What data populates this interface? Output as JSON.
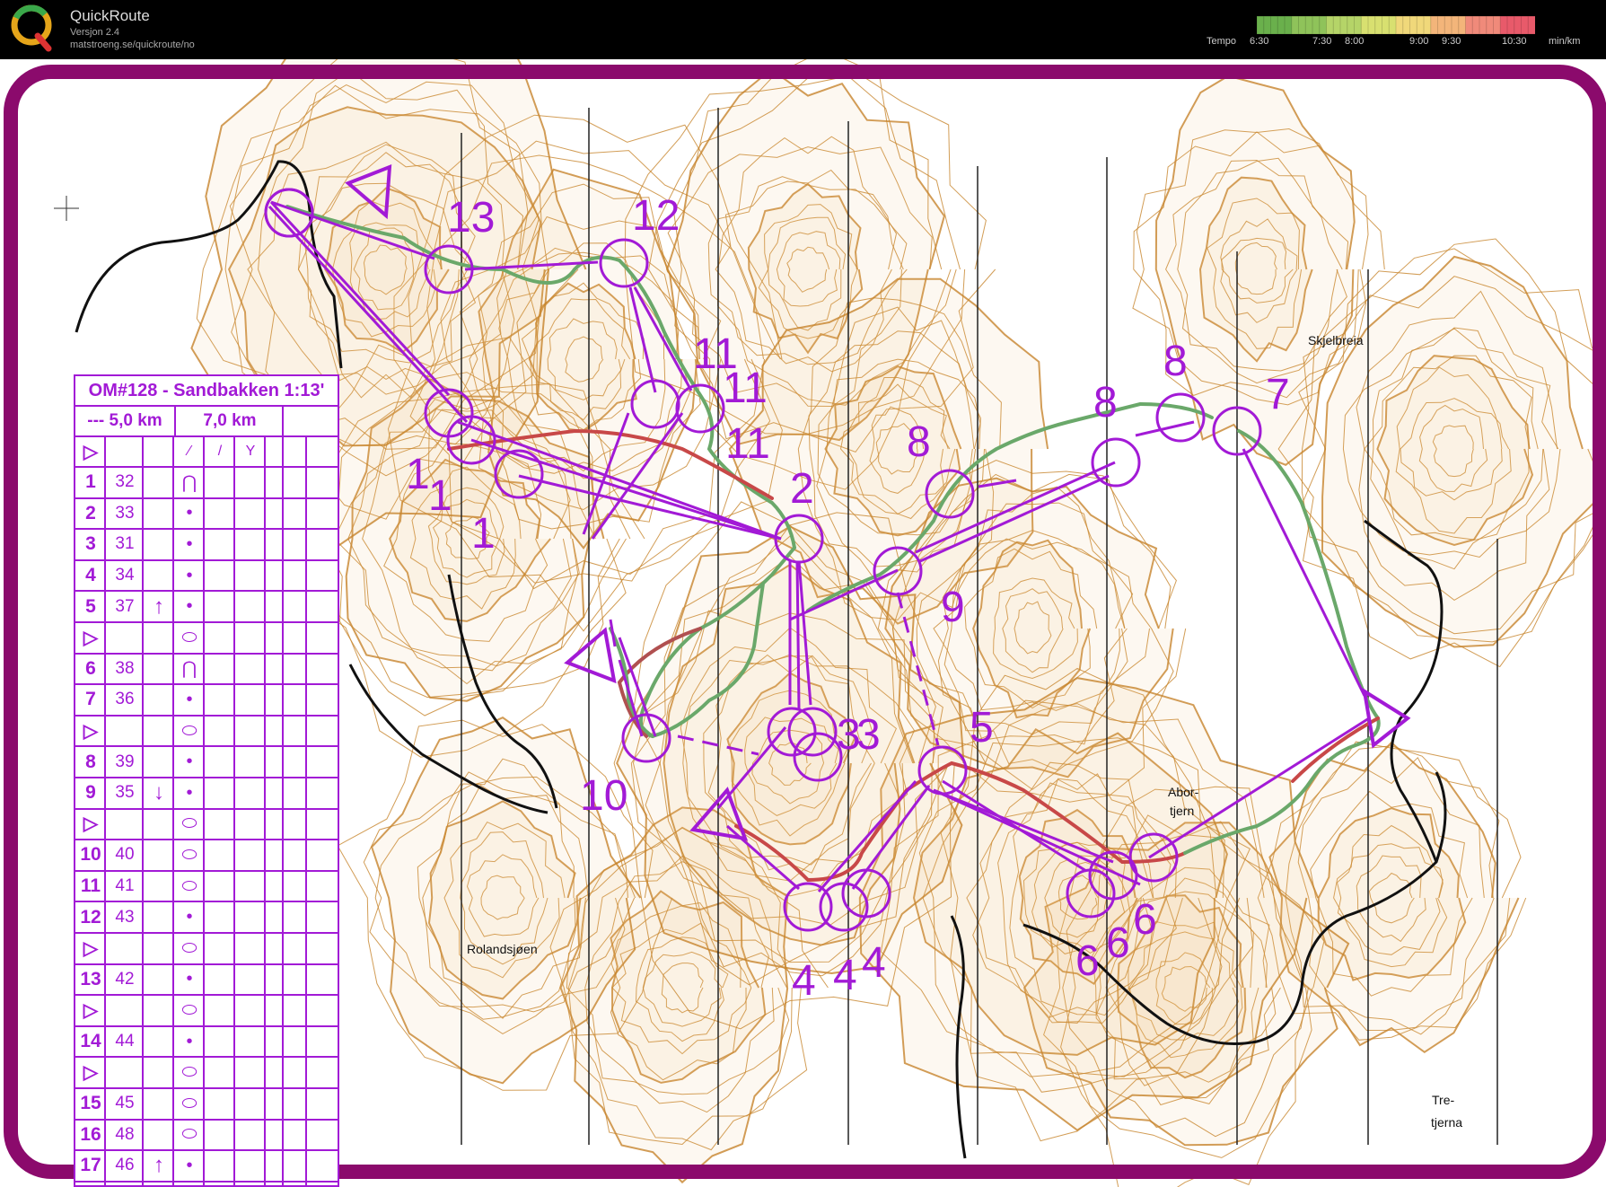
{
  "app": {
    "name": "QuickRoute",
    "version": "Versjon 2.4",
    "url": "matstroeng.se/quickroute/no"
  },
  "pace_scale": {
    "label": "Tempo",
    "ticks": [
      "6:30",
      "7:30",
      "8:00",
      "9:00",
      "9:30",
      "10:30"
    ],
    "unit": "min/km",
    "colors": [
      "#6ab04c",
      "#8fc35a",
      "#b5d468",
      "#d8e070",
      "#f0d87a",
      "#f3b57a",
      "#f08a7a",
      "#e85a6a"
    ]
  },
  "map": {
    "place_names": [
      "Skjelbreia",
      "Abor-",
      "tjern",
      "Rolandsjøen",
      "Tre-",
      "tjerna"
    ],
    "control_numbers": [
      "13",
      "12",
      "11",
      "11",
      "11",
      "1",
      "1",
      "1",
      "2",
      "8",
      "8",
      "8",
      "7",
      "9",
      "3",
      "3",
      "5",
      "10",
      "4",
      "4",
      "4",
      "6",
      "6",
      "6"
    ],
    "colors": {
      "course": "#a21ad6",
      "frame": "#8b0a6c",
      "contour": "#c7842c"
    }
  },
  "description_sheet": {
    "title": "OM#128 - Sandbakken 1:13'",
    "distance_short": "--- 5,0 km",
    "distance_long": "7,0 km",
    "rows": [
      {
        "num": "1",
        "code": "32",
        "mod": "",
        "sym": "⋂"
      },
      {
        "num": "2",
        "code": "33",
        "mod": "",
        "sym": "•"
      },
      {
        "num": "3",
        "code": "31",
        "mod": "",
        "sym": "•"
      },
      {
        "num": "4",
        "code": "34",
        "mod": "",
        "sym": "•"
      },
      {
        "num": "5",
        "code": "37",
        "mod": "↑",
        "sym": "•"
      },
      {
        "num": "▷",
        "code": "",
        "mod": "",
        "sym": "⬭"
      },
      {
        "num": "6",
        "code": "38",
        "mod": "",
        "sym": "⋂"
      },
      {
        "num": "7",
        "code": "36",
        "mod": "",
        "sym": "•"
      },
      {
        "num": "▷",
        "code": "",
        "mod": "",
        "sym": "⬭"
      },
      {
        "num": "8",
        "code": "39",
        "mod": "",
        "sym": "•"
      },
      {
        "num": "9",
        "code": "35",
        "mod": "↓",
        "sym": "•"
      },
      {
        "num": "▷",
        "code": "",
        "mod": "",
        "sym": "⬭"
      },
      {
        "num": "10",
        "code": "40",
        "mod": "",
        "sym": "⬭"
      },
      {
        "num": "11",
        "code": "41",
        "mod": "",
        "sym": "⬭"
      },
      {
        "num": "12",
        "code": "43",
        "mod": "",
        "sym": "•"
      },
      {
        "num": "▷",
        "code": "",
        "mod": "",
        "sym": "⬭"
      },
      {
        "num": "13",
        "code": "42",
        "mod": "",
        "sym": "•"
      },
      {
        "num": "▷",
        "code": "",
        "mod": "",
        "sym": "⬭"
      },
      {
        "num": "14",
        "code": "44",
        "mod": "",
        "sym": "•"
      },
      {
        "num": "▷",
        "code": "",
        "mod": "",
        "sym": "⬭"
      },
      {
        "num": "15",
        "code": "45",
        "mod": "",
        "sym": "⬭"
      },
      {
        "num": "16",
        "code": "48",
        "mod": "",
        "sym": "⬭"
      },
      {
        "num": "17",
        "code": "46",
        "mod": "↑",
        "sym": "•"
      }
    ]
  }
}
